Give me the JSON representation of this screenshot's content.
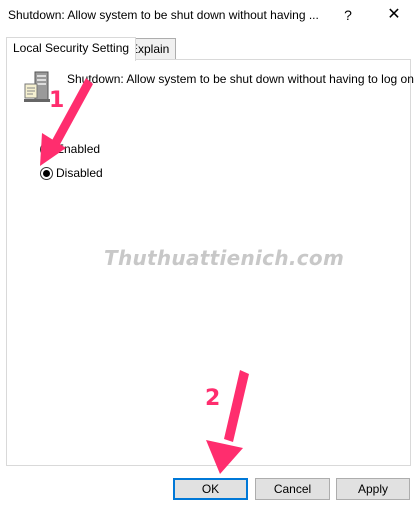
{
  "window": {
    "title": "Shutdown: Allow system to be shut down without having ...",
    "help_glyph": "?",
    "close_glyph": "✕"
  },
  "tabs": [
    {
      "label": "Local Security Setting",
      "active": true
    },
    {
      "label": "Explain",
      "active": false
    }
  ],
  "policy": {
    "icon": "server-policy-icon",
    "description": "Shutdown: Allow system to be shut down without having to log on"
  },
  "options": [
    {
      "label": "Enabled",
      "checked": false
    },
    {
      "label": "Disabled",
      "checked": true
    }
  ],
  "watermark": "Thuthuattienich.com",
  "annotations": {
    "step1": "1",
    "step2": "2",
    "color": "#ff2d6e"
  },
  "buttons": {
    "ok": "OK",
    "cancel": "Cancel",
    "apply": "Apply"
  }
}
